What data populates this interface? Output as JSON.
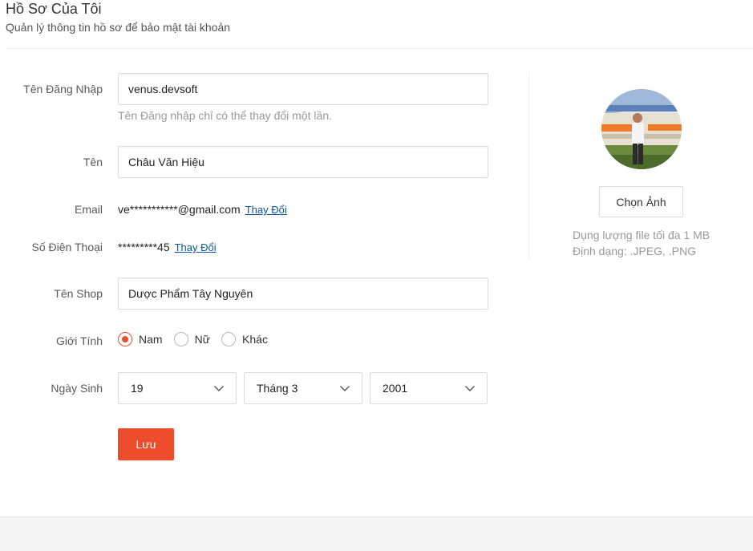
{
  "header": {
    "title": "Hồ Sơ Của Tôi",
    "subtitle": "Quản lý thông tin hồ sơ để bảo mật tài khoản"
  },
  "form": {
    "username": {
      "label": "Tên Đăng Nhập",
      "value": "venus.devsoft",
      "hint": "Tên Đăng nhập chỉ có thể thay đổi một lần."
    },
    "name": {
      "label": "Tên",
      "value": "Châu Văn Hiệu"
    },
    "email": {
      "label": "Email",
      "value": "ve***********@gmail.com",
      "action": "Thay Đổi"
    },
    "phone": {
      "label": "Số Điện Thoại",
      "value": "*********45",
      "action": "Thay Đổi"
    },
    "shop": {
      "label": "Tên Shop",
      "value": "Dược Phẩm Tây Nguyên"
    },
    "gender": {
      "label": "Giới Tính",
      "options": [
        "Nam",
        "Nữ",
        "Khác"
      ],
      "selected": "Nam"
    },
    "birthday": {
      "label": "Ngày Sinh",
      "day": "19",
      "month": "Tháng 3",
      "year": "2001"
    },
    "save_label": "Lưu"
  },
  "avatar_panel": {
    "choose_label": "Chọn Ảnh",
    "size_note": "Dụng lượng file tối đa 1 MB",
    "format_note": "Định dạng: .JPEG, .PNG"
  },
  "colors": {
    "accent": "#ee4d2d",
    "link": "#0b57a4",
    "muted": "#999999"
  },
  "icons": {
    "select_arrow": "chevron-down-icon",
    "avatar": "user-photo"
  }
}
